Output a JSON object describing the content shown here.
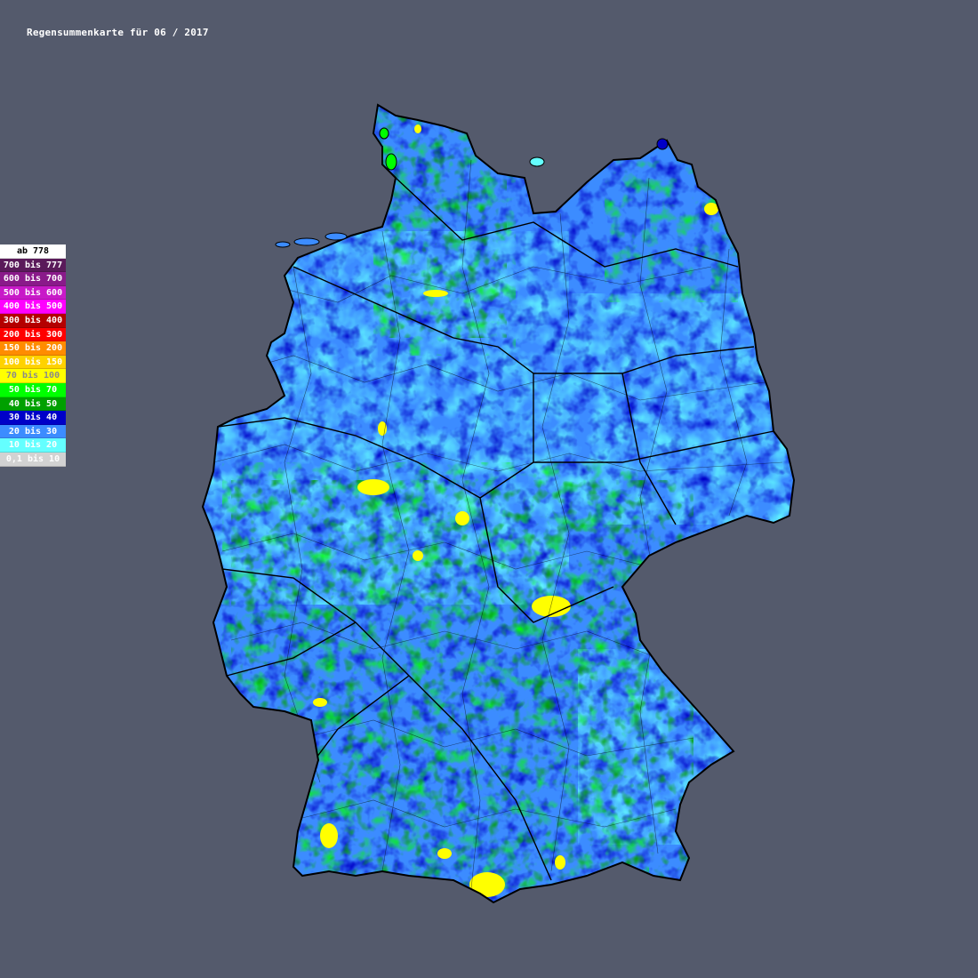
{
  "title": "Regensummenkarte für 06 / 2017",
  "legend": {
    "items": [
      {
        "label": "ab 778",
        "color": "#ffffff",
        "text_color": "#000000"
      },
      {
        "label": "700 bis 777",
        "color": "#5a1a5a",
        "text_color": "#ffffff"
      },
      {
        "label": "600 bis 700",
        "color": "#8a1a8a",
        "text_color": "#ffffff"
      },
      {
        "label": "500 bis 600",
        "color": "#c81ac8",
        "text_color": "#ffffff"
      },
      {
        "label": "400 bis 500",
        "color": "#ff00ff",
        "text_color": "#ffffff"
      },
      {
        "label": "300 bis 400",
        "color": "#b40000",
        "text_color": "#ffffff"
      },
      {
        "label": "200 bis 300",
        "color": "#ff0000",
        "text_color": "#ffffff"
      },
      {
        "label": "150 bis 200",
        "color": "#ff8c00",
        "text_color": "#ffffff"
      },
      {
        "label": "100 bis 150",
        "color": "#ffd200",
        "text_color": "#ffffff"
      },
      {
        "label": "70 bis 100",
        "color": "#ffff00",
        "text_color": "#8a8a8a"
      },
      {
        "label": "50 bis 70",
        "color": "#00ff00",
        "text_color": "#ffffff"
      },
      {
        "label": "40 bis 50",
        "color": "#00a000",
        "text_color": "#ffffff"
      },
      {
        "label": "30 bis 40",
        "color": "#0000c8",
        "text_color": "#ffffff"
      },
      {
        "label": "20 bis 30",
        "color": "#3c8cff",
        "text_color": "#ffffff"
      },
      {
        "label": "10 bis 20",
        "color": "#64ffff",
        "text_color": "#ffffff"
      },
      {
        "label": "0,1 bis 10",
        "color": "#d2d2d2",
        "text_color": "#ffffff"
      }
    ]
  },
  "map": {
    "region": "Deutschland",
    "water_color": "#545a6c",
    "border_color": "#000000"
  }
}
